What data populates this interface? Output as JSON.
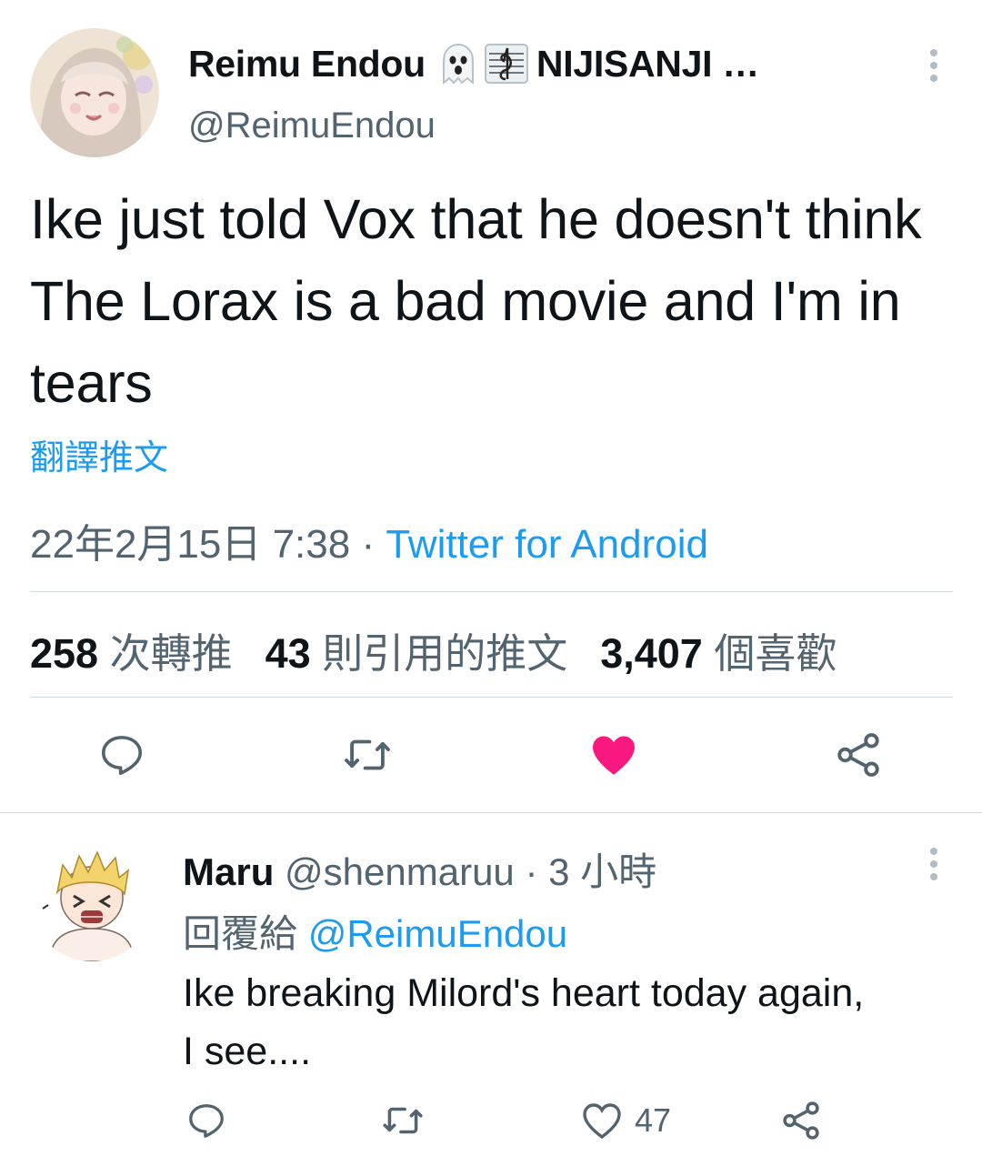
{
  "tweet": {
    "author_name": "Reimu Endou",
    "author_emojis": [
      "ghost-emoji",
      "music-score-emoji"
    ],
    "author_org": "NIJISANJI …",
    "handle": "@ReimuEndou",
    "text": "Ike just told Vox that he doesn't think The Lorax is a bad movie and I'm in tears",
    "translate_label": "翻譯推文",
    "timestamp": "22年2月15日 7:38",
    "separator": "·",
    "source": "Twitter for Android",
    "stats": {
      "retweets_count": "258",
      "retweets_label": "次轉推",
      "quotes_count": "43",
      "quotes_label": "則引用的推文",
      "likes_count": "3,407",
      "likes_label": "個喜歡"
    },
    "liked": true,
    "like_color": "#f91880"
  },
  "reply": {
    "author_name": "Maru",
    "handle": "@shenmaruu",
    "separator": "·",
    "time": "3 小時",
    "replying_label": "回覆給",
    "replying_to": "@ReimuEndou",
    "text_line1": "Ike breaking Milord's heart today again,",
    "text_line2": "I see....",
    "like_count": "47"
  },
  "colors": {
    "accent": "#1d9bf0",
    "secondary_text": "#536471",
    "primary_text": "#0f1419",
    "divider": "#cfd9de"
  }
}
